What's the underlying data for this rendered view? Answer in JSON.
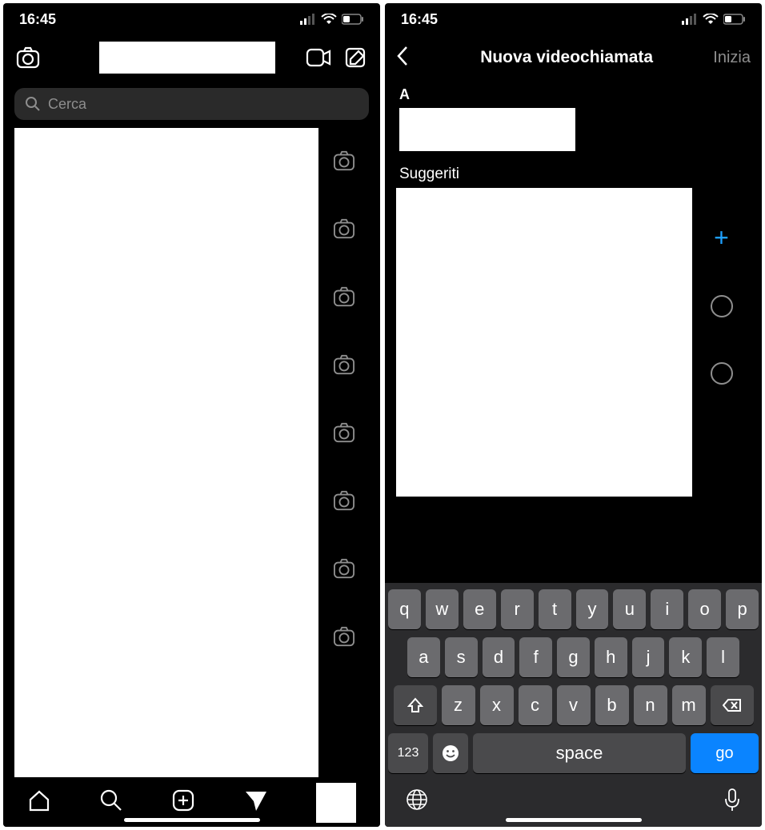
{
  "status": {
    "time": "16:45"
  },
  "left": {
    "search_placeholder": "Cerca"
  },
  "right": {
    "title": "Nuova videochiamata",
    "action_label": "Inizia",
    "to_label": "A",
    "suggest_label": "Suggeriti"
  },
  "keyboard": {
    "row1": [
      "q",
      "w",
      "e",
      "r",
      "t",
      "y",
      "u",
      "i",
      "o",
      "p"
    ],
    "row2": [
      "a",
      "s",
      "d",
      "f",
      "g",
      "h",
      "j",
      "k",
      "l"
    ],
    "row3": [
      "z",
      "x",
      "c",
      "v",
      "b",
      "n",
      "m"
    ],
    "numkey": "123",
    "space": "space",
    "go": "go"
  }
}
